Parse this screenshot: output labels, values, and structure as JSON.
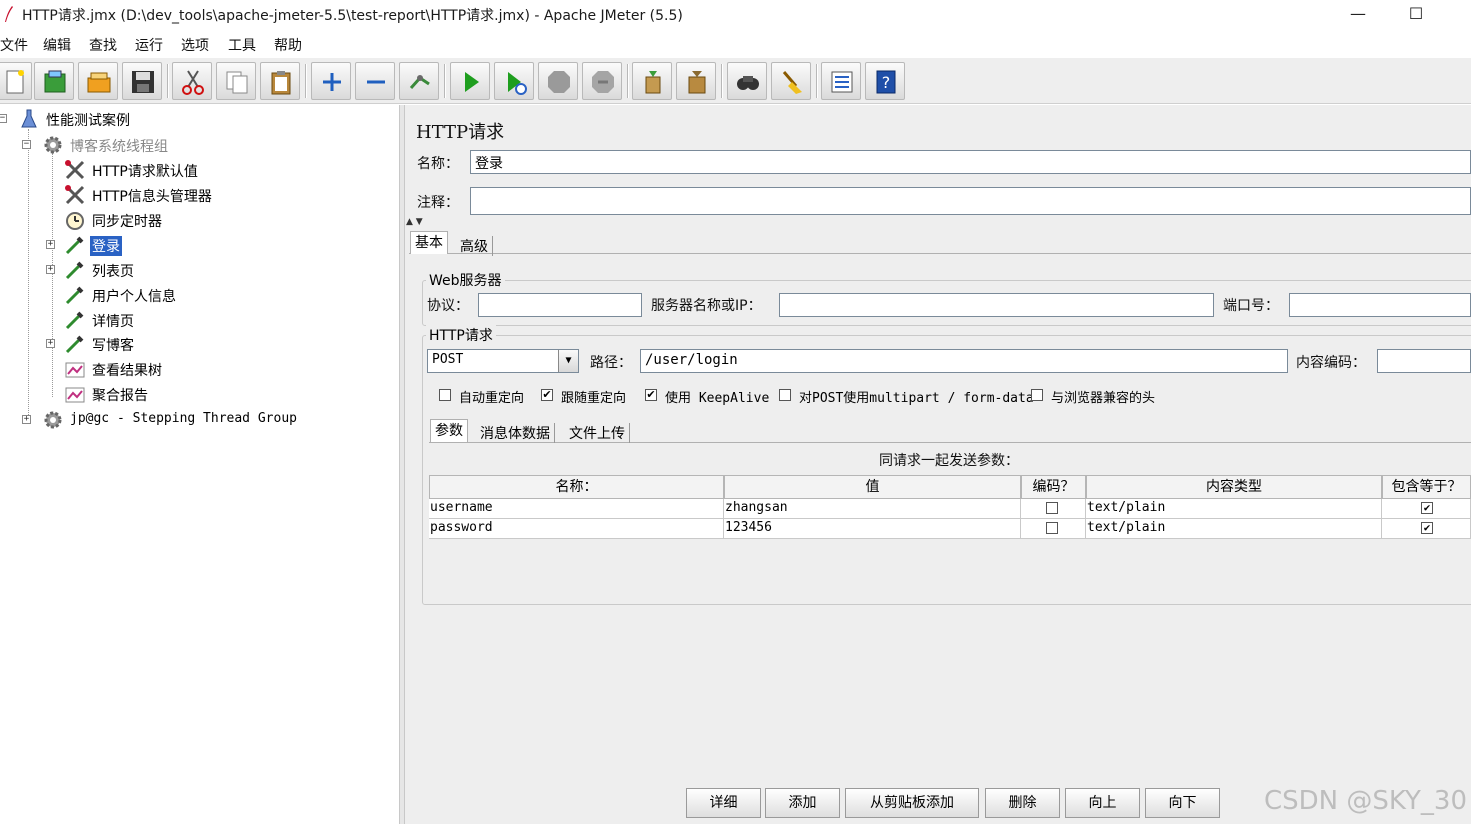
{
  "window": {
    "title": "HTTP请求.jmx (D:\\dev_tools\\apache-jmeter-5.5\\test-report\\HTTP请求.jmx) - Apache JMeter (5.5)",
    "minimize": "—",
    "maximize": "☐"
  },
  "menu": [
    "文件",
    "编辑",
    "查找",
    "运行",
    "选项",
    "工具",
    "帮助"
  ],
  "toolbar": {
    "icons": [
      "new-icon",
      "templates-icon",
      "open-icon",
      "save-icon",
      "cut-icon",
      "copy-icon",
      "paste-icon",
      "expand-icon",
      "collapse-icon",
      "toggle-icon",
      "start-icon",
      "start-no-pause-icon",
      "stop-icon",
      "shutdown-icon",
      "clear-icon",
      "clear-all-icon",
      "search-icon",
      "reset-search-icon",
      "function-helper-icon",
      "help-icon"
    ]
  },
  "tree": {
    "root": "性能测试案例",
    "thread_group": "博客系统线程组",
    "children": [
      "HTTP请求默认值",
      "HTTP信息头管理器",
      "同步定时器",
      "登录",
      "列表页",
      "用户个人信息",
      "详情页",
      "写博客",
      "查看结果树",
      "聚合报告"
    ],
    "second_group": "jp@gc - Stepping Thread Group"
  },
  "panel": {
    "heading": "HTTP请求",
    "name_label": "名称：",
    "name_value": "登录",
    "comment_label": "注释：",
    "comment_value": "",
    "tabs": [
      "基本",
      "高级"
    ],
    "web_server": {
      "title": "Web服务器",
      "protocol_label": "协议：",
      "protocol_value": "",
      "server_label": "服务器名称或IP：",
      "server_value": "",
      "port_label": "端口号：",
      "port_value": ""
    },
    "http_request": {
      "title": "HTTP请求",
      "method": "POST",
      "path_label": "路径：",
      "path_value": "/user/login",
      "encoding_label": "内容编码：",
      "encoding_value": ""
    },
    "options": [
      {
        "label": "自动重定向",
        "checked": false
      },
      {
        "label": "跟随重定向",
        "checked": true
      },
      {
        "label": "使用 KeepAlive",
        "checked": true
      },
      {
        "label": "对POST使用multipart / form-data",
        "checked": false
      },
      {
        "label": "与浏览器兼容的头",
        "checked": false
      }
    ],
    "sub_tabs": [
      "参数",
      "消息体数据",
      "文件上传"
    ],
    "params_caption": "同请求一起发送参数：",
    "columns": [
      "名称：",
      "值",
      "编码？",
      "内容类型",
      "包含等于？"
    ],
    "rows": [
      {
        "name": "username",
        "value": "zhangsan",
        "encode": false,
        "content_type": "text/plain",
        "include_equals": true
      },
      {
        "name": "password",
        "value": "123456",
        "encode": false,
        "content_type": "text/plain",
        "include_equals": true
      }
    ],
    "buttons": [
      "详细",
      "添加",
      "从剪贴板添加",
      "删除",
      "向上",
      "向下"
    ]
  },
  "watermark": "CSDN @SKY_30",
  "colors": {
    "selection": "#2a62c4",
    "panel_bg": "#eeeeee"
  }
}
